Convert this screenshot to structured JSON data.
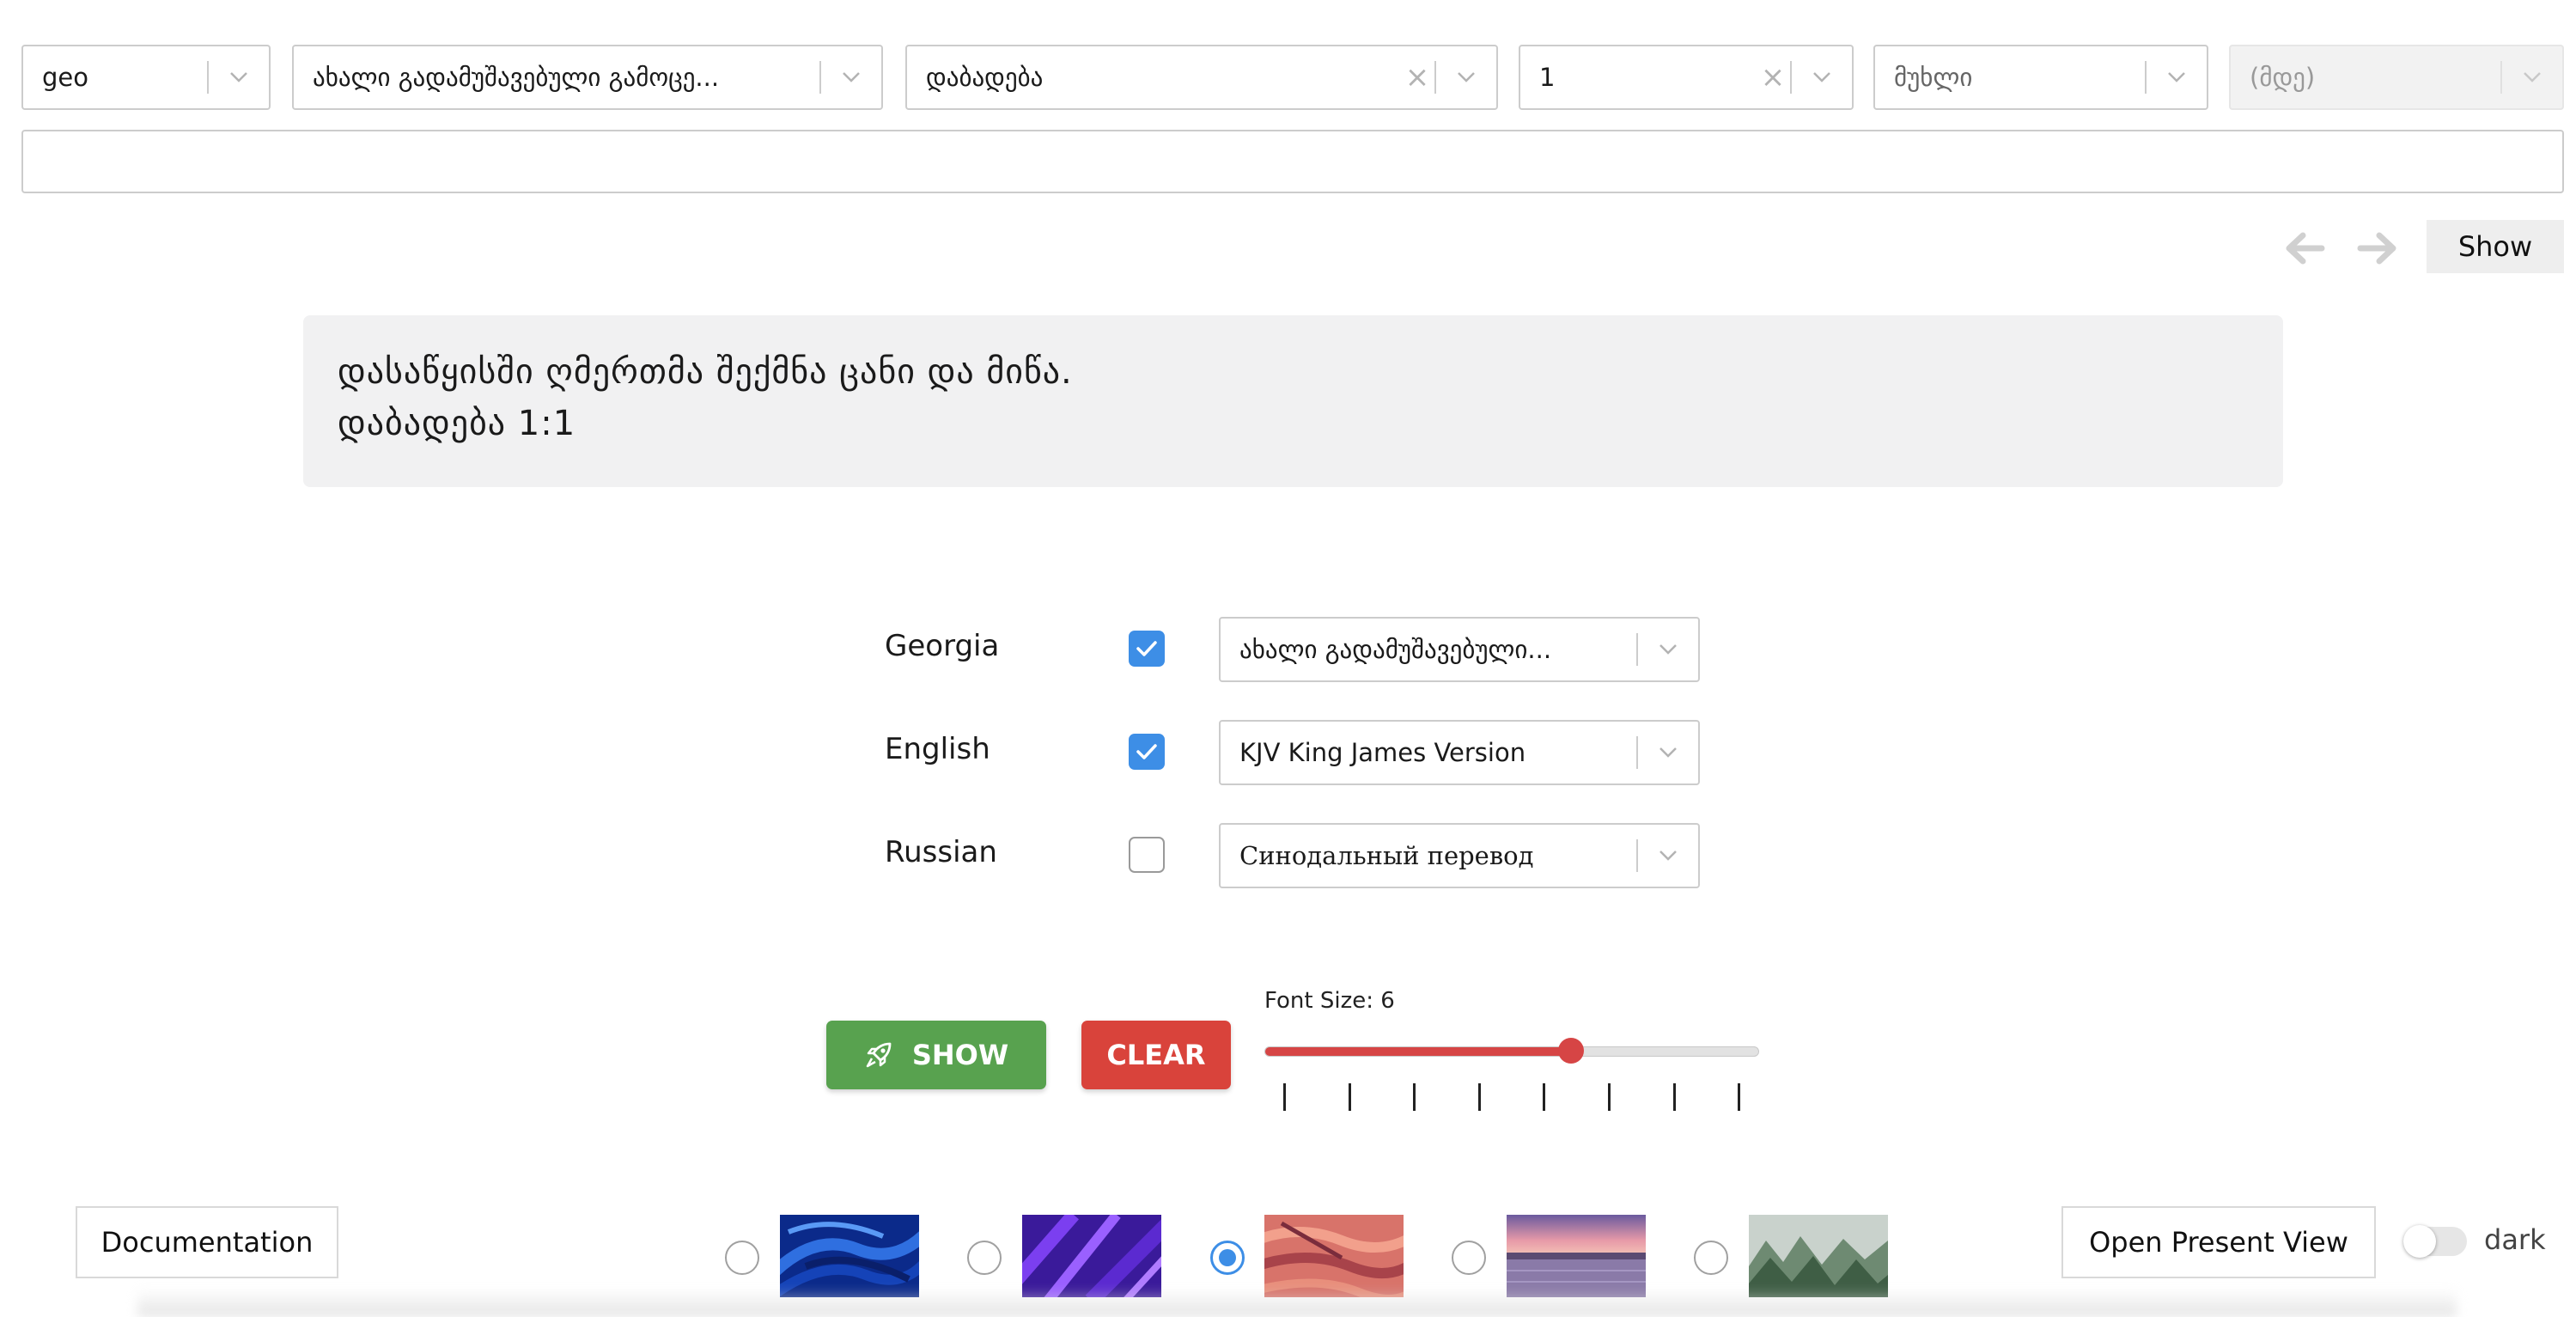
{
  "top_selects": {
    "language": {
      "value": "geo"
    },
    "translation": {
      "value": "ახალი გადამუშავებული გამოცე..."
    },
    "book": {
      "value": "დაბადება"
    },
    "chapter": {
      "value": "1"
    },
    "verse": {
      "value": "მუხლი"
    },
    "verse_end": {
      "value": "(მდე)"
    }
  },
  "search": {
    "value": ""
  },
  "nav": {
    "show_label": "Show"
  },
  "verse_display": {
    "text": "დასაწყისში ღმერთმა შექმნა ცანი და მიწა.",
    "reference": "დაბადება 1:1"
  },
  "languages": [
    {
      "label": "Georgia",
      "checked": true,
      "translation": "ახალი გადამუშავებული..."
    },
    {
      "label": "English",
      "checked": true,
      "translation": "KJV King James Version"
    },
    {
      "label": "Russian",
      "checked": false,
      "translation": "Синодальный перевод"
    }
  ],
  "actions": {
    "show_label": "SHOW",
    "clear_label": "CLEAR"
  },
  "font_size": {
    "label": "Font Size: 6",
    "value": 6,
    "min": 1,
    "max": 9,
    "ticks": 8
  },
  "footer": {
    "documentation_label": "Documentation",
    "present_view_label": "Open Present View",
    "dark_label": "dark",
    "dark_enabled": false,
    "selected_background": 2,
    "backgrounds": [
      "blue-brush",
      "purple-brush",
      "coral-brush",
      "sunset-lake",
      "misty-forest"
    ]
  },
  "colors": {
    "show": "#58a24f",
    "clear": "#d9433b",
    "accent": "#3d8ee6",
    "slider": "#d64545"
  }
}
